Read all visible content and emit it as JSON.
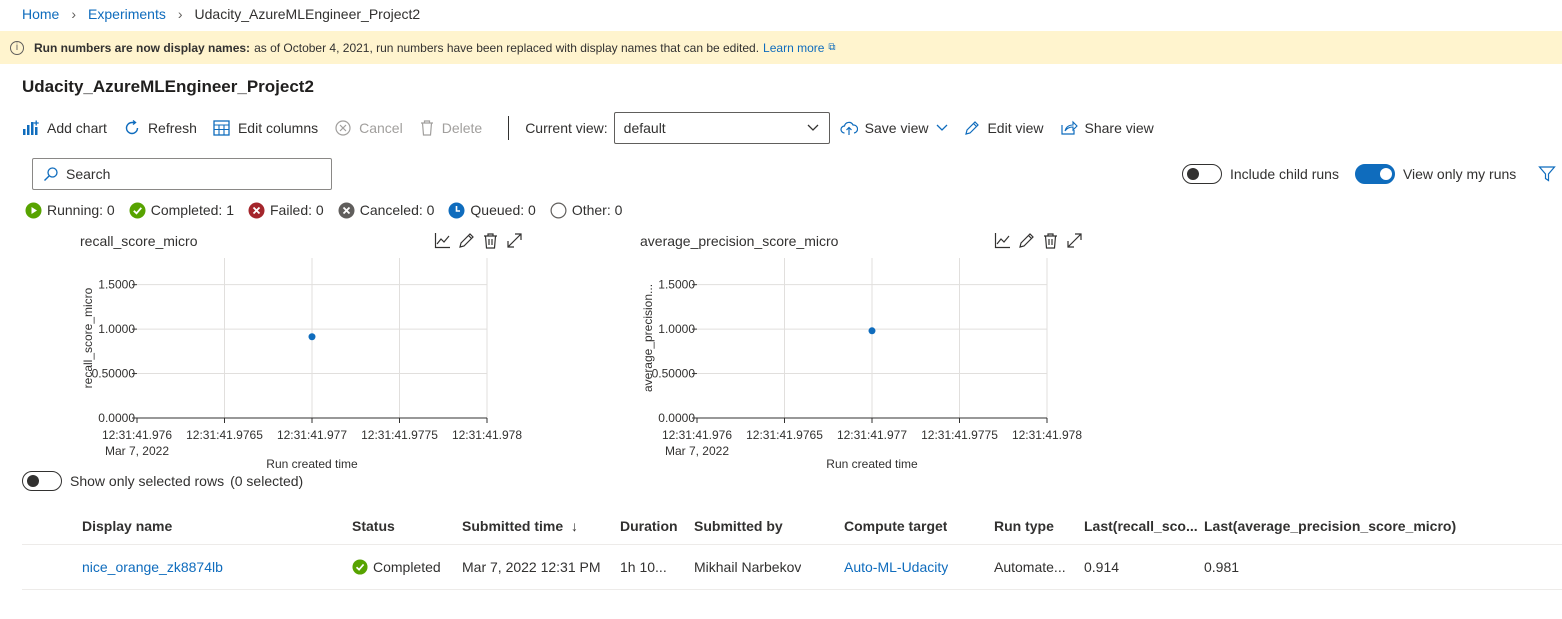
{
  "breadcrumb": {
    "items": [
      "Home",
      "Experiments"
    ],
    "current": "Udacity_AzureMLEngineer_Project2"
  },
  "banner": {
    "bold": "Run numbers are now display names:",
    "text": "as of October 4, 2021, run numbers have been replaced with display names that can be edited.",
    "link": "Learn more"
  },
  "page": {
    "title": "Udacity_AzureMLEngineer_Project2"
  },
  "toolbar": {
    "add_chart": "Add chart",
    "refresh": "Refresh",
    "edit_columns": "Edit columns",
    "cancel": "Cancel",
    "delete": "Delete",
    "current_view_label": "Current view:",
    "current_view_value": "default",
    "save_view": "Save view",
    "edit_view": "Edit view",
    "share_view": "Share view"
  },
  "search": {
    "placeholder": "Search"
  },
  "filters": {
    "include_child_runs": "Include child runs",
    "include_child_runs_on": false,
    "view_only_my_runs": "View only my runs",
    "view_only_my_runs_on": true
  },
  "status_counts": [
    {
      "label": "Running: 0",
      "icon": "play-icon",
      "color": "#57a300"
    },
    {
      "label": "Completed: 1",
      "icon": "check-icon",
      "color": "#57a300"
    },
    {
      "label": "Failed: 0",
      "icon": "x-icon",
      "color": "#a4262c"
    },
    {
      "label": "Canceled: 0",
      "icon": "cancel-icon",
      "color": "#605e5c"
    },
    {
      "label": "Queued: 0",
      "icon": "clock-icon",
      "color": "#0f6cbd"
    },
    {
      "label": "Other: 0",
      "icon": "circle-icon",
      "color": "#605e5c"
    }
  ],
  "chart_data": [
    {
      "type": "scatter",
      "title": "recall_score_micro",
      "xlabel": "Run created time",
      "ylabel": "recall_score_micro",
      "x_ticks": [
        "12:31:41.976",
        "12:31:41.9765",
        "12:31:41.977",
        "12:31:41.9775",
        "12:31:41.978"
      ],
      "x_tick_sub": "Mar 7, 2022",
      "y_ticks": [
        "0.0000",
        "0.50000",
        "1.0000",
        "1.5000"
      ],
      "ylim": [
        0,
        1.8
      ],
      "xlim": [
        0,
        4
      ],
      "points": [
        {
          "x": 2,
          "y": 0.914
        }
      ],
      "color": "#0f6cbd",
      "grid": true
    },
    {
      "type": "scatter",
      "title": "average_precision_score_micro",
      "xlabel": "Run created time",
      "ylabel": "average_precision...",
      "x_ticks": [
        "12:31:41.976",
        "12:31:41.9765",
        "12:31:41.977",
        "12:31:41.9775",
        "12:31:41.978"
      ],
      "x_tick_sub": "Mar 7, 2022",
      "y_ticks": [
        "0.0000",
        "0.50000",
        "1.0000",
        "1.5000"
      ],
      "ylim": [
        0,
        1.8
      ],
      "xlim": [
        0,
        4
      ],
      "points": [
        {
          "x": 2,
          "y": 0.981
        }
      ],
      "color": "#0f6cbd",
      "grid": true
    }
  ],
  "show_selected": {
    "label": "Show only selected rows",
    "count": "(0 selected)"
  },
  "table": {
    "columns": [
      "Display name",
      "Status",
      "Submitted time",
      "Duration",
      "Submitted by",
      "Compute target",
      "Run type",
      "Last(recall_sco...",
      "Last(average_precision_score_micro)"
    ],
    "sort_indicator": "↓",
    "rows": [
      {
        "display_name": "nice_orange_zk8874lb",
        "status": "Completed",
        "submitted_time": "Mar 7, 2022 12:31 PM",
        "duration": "1h 10...",
        "submitted_by": "Mikhail Narbekov",
        "compute_target": "Auto-ML-Udacity",
        "run_type": "Automate...",
        "last_recall": "0.914",
        "last_avg_precision": "0.981"
      }
    ]
  }
}
